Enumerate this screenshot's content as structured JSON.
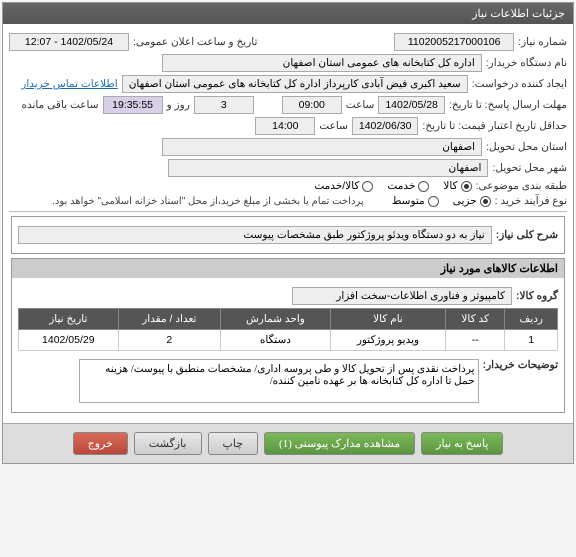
{
  "panel_title": "جزئیات اطلاعات نیاز",
  "fields": {
    "need_no_label": "شماره نیاز:",
    "need_no": "1102005217000106",
    "announce_label": "تاریخ و ساعت اعلان عمومی:",
    "announce": "1402/05/24 - 12:07",
    "buyer_label": "نام دستگاه خریدار:",
    "buyer": "اداره کل کتابخانه های عمومی استان اصفهان",
    "creator_label": "ایجاد کننده درخواست:",
    "creator": "سعید اکبری فیض آبادی کارپرداز اداره کل کتابخانه های عمومی استان اصفهان",
    "contact_link": "اطلاعات تماس خریدار",
    "deadline_label": "مهلت ارسال پاسخ: تا تاریخ:",
    "deadline_date": "1402/05/28",
    "time_lbl": "ساعت",
    "deadline_time": "09:00",
    "remain_lbl1": "",
    "remain_days": "3",
    "remain_lbl2": "روز و",
    "remain_time": "19:35:55",
    "remain_lbl3": "ساعت باقی مانده",
    "validity_label": "حداقل تاریخ اعتبار قیمت: تا تاریخ:",
    "validity_date": "1402/06/30",
    "validity_time": "14:00",
    "province_deliver_label": "استان محل تحویل:",
    "province_deliver": "اصفهان",
    "city_deliver_label": "شهر محل تحویل:",
    "city_deliver": "اصفهان",
    "subject_label": "طبقه بندی موضوعی:",
    "process_label": "نوع فرآیند خرید :",
    "pay_note": "پرداخت تمام یا بخشی از مبلغ خرید،از محل \"اسناد خزانه اسلامی\" خواهد بود."
  },
  "subject_opts": [
    {
      "label": "کالا",
      "selected": true
    },
    {
      "label": "خدمت",
      "selected": false
    },
    {
      "label": "کالا/خدمت",
      "selected": false
    }
  ],
  "process_opts": [
    {
      "label": "جزیی",
      "selected": true
    },
    {
      "label": "متوسط",
      "selected": false
    }
  ],
  "desc": {
    "label": "شرح کلی نیاز:",
    "value": "نیاز به دو دستگاه ویدئو پروژکتور طبق مشخصات پیوست"
  },
  "items_panel": {
    "title": "اطلاعات کالاهای مورد نیاز",
    "group_label": "گروه کالا:",
    "group_value": "کامپیوتر و فناوری اطلاعات-سخت افزار"
  },
  "table": {
    "headers": [
      "ردیف",
      "کد کالا",
      "نام کالا",
      "واحد شمارش",
      "تعداد / مقدار",
      "تاریخ نیاز"
    ],
    "rows": [
      {
        "idx": "1",
        "code": "--",
        "name": "ویدیو پروژکتور",
        "unit": "دستگاه",
        "qty": "2",
        "date": "1402/05/29"
      }
    ]
  },
  "buyer_notes": {
    "label": "توضیحات خریدار:",
    "value": "پرداخت نقدی پس از تحویل کالا و طی پروسه اداری/ مشخصات منطبق با پیوست/ هزینه حمل تا اداره کل کتابخانه ها بر عهده تامین کننده/"
  },
  "buttons": {
    "respond": "پاسخ به نیاز",
    "attachments": "مشاهده مدارک پیوستی (1)",
    "print": "چاپ",
    "back": "بازگشت",
    "exit": "خروج"
  }
}
